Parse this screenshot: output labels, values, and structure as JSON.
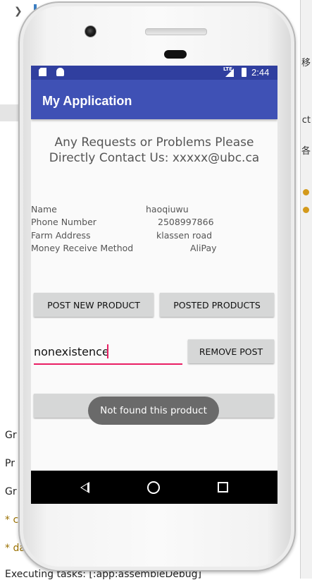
{
  "background": {
    "right_panel_chars": [
      "移",
      "ct",
      "各"
    ],
    "log_lines": [
      "Gr",
      "Pr",
      "Gr",
      "* c",
      "* da"
    ],
    "executing": "Executing tasks: [:app:assembleDebug]"
  },
  "status_bar": {
    "network": "LTE",
    "time": "2:44"
  },
  "app_bar": {
    "title": "My Application"
  },
  "contact": {
    "line1": "Any Requests or Problems Please",
    "line2": "Directly Contact Us: xxxxx@ubc.ca"
  },
  "info": {
    "name_label": "Name",
    "name_value": "haoqiuwu",
    "phone_label": "Phone Number",
    "phone_value": "2508997866",
    "farm_label": "Farm Address",
    "farm_value": "klassen road",
    "money_label": "Money Receive Method",
    "money_value": "AliPay"
  },
  "buttons": {
    "post_new": "POST NEW PRODUCT",
    "posted": "POSTED PRODUCTS",
    "remove": "REMOVE POST",
    "logout": "LOG OFF"
  },
  "search": {
    "value": "nonexistence"
  },
  "toast": {
    "message": "Not found this product"
  },
  "colors": {
    "status_bar": "#303f9f",
    "app_bar": "#3f51b5",
    "input_underline": "#e91e63",
    "toast": "#6a6a6a"
  }
}
